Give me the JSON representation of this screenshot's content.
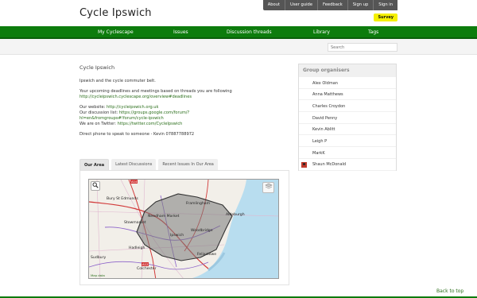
{
  "site": {
    "title": "Cycle Ipswich",
    "survey_label": "Survey"
  },
  "utility_nav": [
    "About",
    "User guide",
    "Feedback",
    "Sign up",
    "Sign in"
  ],
  "main_nav": [
    "My Cyclescape",
    "Issues",
    "Discussion threads",
    "Library",
    "Tags"
  ],
  "search": {
    "placeholder": "Search"
  },
  "content": {
    "page_title": "Cycle Ipswich",
    "intro": "Ipswich and the cycle commuter belt.",
    "deadlines_text": "Your upcoming deadlines and meetings based on threads you are following",
    "deadlines_link": "http://cycleipswich.cyclescape.org/overview#deadlines",
    "website_label": "Our website:",
    "website_link": "http://cycleipswich.org.uk",
    "discussion_label": "Our discussion list:",
    "discussion_link_1": "https://groups.google.com/forum/?",
    "discussion_link_2": "hl=en&fromgroups#!forum/cycle-ipswich",
    "twitter_label": "We are on Twitter:",
    "twitter_link": "https://twitter.com/CycleIpswich",
    "phone_text": "Direct phone to speak to someone - Kevin 07887788972"
  },
  "tabs": [
    "Our Area",
    "Latest Discussions",
    "Recent Issues In Our Area"
  ],
  "map": {
    "labels": [
      "Bury St Edmunds",
      "Stowmarket",
      "Needham Market",
      "Framlingham",
      "Aldeburgh",
      "Ipswich",
      "Felixstowe",
      "Colchester",
      "Woodbridge",
      "Hadleigh",
      "Sudbury",
      "A12",
      "A14"
    ],
    "attribution": "Map data",
    "zoom_icon": "search-icon",
    "layers_icon": "layers-icon",
    "sea_color": "#b8ddef",
    "land_color": "#f2efe9",
    "area_color": "#7a7a7a"
  },
  "sidebar": {
    "title": "Group organisers",
    "organisers": [
      "Alex Oldman",
      "Anna Matthews",
      "Charles Croydon",
      "David Penny",
      "Kevin Ablitt",
      "Leigh P",
      "MarkK",
      "Shaun McDonald"
    ]
  },
  "footer": {
    "back_to_top": "Back to top"
  },
  "colors": {
    "brand_green": "#0d7c0d",
    "link_green": "#2a6e1a",
    "survey_yellow": "#f5f000"
  }
}
